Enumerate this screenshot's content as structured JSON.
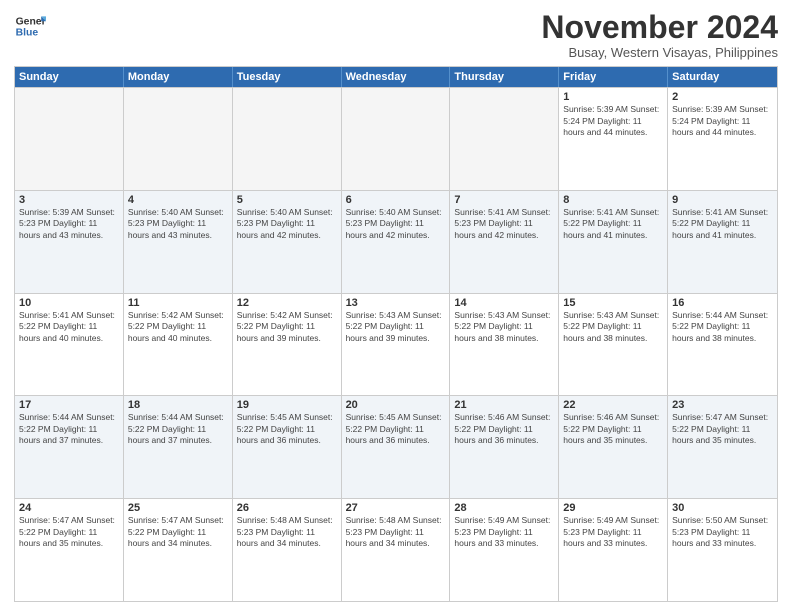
{
  "header": {
    "logo_line1": "General",
    "logo_line2": "Blue",
    "month": "November 2024",
    "location": "Busay, Western Visayas, Philippines"
  },
  "days_of_week": [
    "Sunday",
    "Monday",
    "Tuesday",
    "Wednesday",
    "Thursday",
    "Friday",
    "Saturday"
  ],
  "weeks": [
    [
      {
        "day": "",
        "info": ""
      },
      {
        "day": "",
        "info": ""
      },
      {
        "day": "",
        "info": ""
      },
      {
        "day": "",
        "info": ""
      },
      {
        "day": "",
        "info": ""
      },
      {
        "day": "1",
        "info": "Sunrise: 5:39 AM\nSunset: 5:24 PM\nDaylight: 11 hours\nand 44 minutes."
      },
      {
        "day": "2",
        "info": "Sunrise: 5:39 AM\nSunset: 5:24 PM\nDaylight: 11 hours\nand 44 minutes."
      }
    ],
    [
      {
        "day": "3",
        "info": "Sunrise: 5:39 AM\nSunset: 5:23 PM\nDaylight: 11 hours\nand 43 minutes."
      },
      {
        "day": "4",
        "info": "Sunrise: 5:40 AM\nSunset: 5:23 PM\nDaylight: 11 hours\nand 43 minutes."
      },
      {
        "day": "5",
        "info": "Sunrise: 5:40 AM\nSunset: 5:23 PM\nDaylight: 11 hours\nand 42 minutes."
      },
      {
        "day": "6",
        "info": "Sunrise: 5:40 AM\nSunset: 5:23 PM\nDaylight: 11 hours\nand 42 minutes."
      },
      {
        "day": "7",
        "info": "Sunrise: 5:41 AM\nSunset: 5:23 PM\nDaylight: 11 hours\nand 42 minutes."
      },
      {
        "day": "8",
        "info": "Sunrise: 5:41 AM\nSunset: 5:22 PM\nDaylight: 11 hours\nand 41 minutes."
      },
      {
        "day": "9",
        "info": "Sunrise: 5:41 AM\nSunset: 5:22 PM\nDaylight: 11 hours\nand 41 minutes."
      }
    ],
    [
      {
        "day": "10",
        "info": "Sunrise: 5:41 AM\nSunset: 5:22 PM\nDaylight: 11 hours\nand 40 minutes."
      },
      {
        "day": "11",
        "info": "Sunrise: 5:42 AM\nSunset: 5:22 PM\nDaylight: 11 hours\nand 40 minutes."
      },
      {
        "day": "12",
        "info": "Sunrise: 5:42 AM\nSunset: 5:22 PM\nDaylight: 11 hours\nand 39 minutes."
      },
      {
        "day": "13",
        "info": "Sunrise: 5:43 AM\nSunset: 5:22 PM\nDaylight: 11 hours\nand 39 minutes."
      },
      {
        "day": "14",
        "info": "Sunrise: 5:43 AM\nSunset: 5:22 PM\nDaylight: 11 hours\nand 38 minutes."
      },
      {
        "day": "15",
        "info": "Sunrise: 5:43 AM\nSunset: 5:22 PM\nDaylight: 11 hours\nand 38 minutes."
      },
      {
        "day": "16",
        "info": "Sunrise: 5:44 AM\nSunset: 5:22 PM\nDaylight: 11 hours\nand 38 minutes."
      }
    ],
    [
      {
        "day": "17",
        "info": "Sunrise: 5:44 AM\nSunset: 5:22 PM\nDaylight: 11 hours\nand 37 minutes."
      },
      {
        "day": "18",
        "info": "Sunrise: 5:44 AM\nSunset: 5:22 PM\nDaylight: 11 hours\nand 37 minutes."
      },
      {
        "day": "19",
        "info": "Sunrise: 5:45 AM\nSunset: 5:22 PM\nDaylight: 11 hours\nand 36 minutes."
      },
      {
        "day": "20",
        "info": "Sunrise: 5:45 AM\nSunset: 5:22 PM\nDaylight: 11 hours\nand 36 minutes."
      },
      {
        "day": "21",
        "info": "Sunrise: 5:46 AM\nSunset: 5:22 PM\nDaylight: 11 hours\nand 36 minutes."
      },
      {
        "day": "22",
        "info": "Sunrise: 5:46 AM\nSunset: 5:22 PM\nDaylight: 11 hours\nand 35 minutes."
      },
      {
        "day": "23",
        "info": "Sunrise: 5:47 AM\nSunset: 5:22 PM\nDaylight: 11 hours\nand 35 minutes."
      }
    ],
    [
      {
        "day": "24",
        "info": "Sunrise: 5:47 AM\nSunset: 5:22 PM\nDaylight: 11 hours\nand 35 minutes."
      },
      {
        "day": "25",
        "info": "Sunrise: 5:47 AM\nSunset: 5:22 PM\nDaylight: 11 hours\nand 34 minutes."
      },
      {
        "day": "26",
        "info": "Sunrise: 5:48 AM\nSunset: 5:23 PM\nDaylight: 11 hours\nand 34 minutes."
      },
      {
        "day": "27",
        "info": "Sunrise: 5:48 AM\nSunset: 5:23 PM\nDaylight: 11 hours\nand 34 minutes."
      },
      {
        "day": "28",
        "info": "Sunrise: 5:49 AM\nSunset: 5:23 PM\nDaylight: 11 hours\nand 33 minutes."
      },
      {
        "day": "29",
        "info": "Sunrise: 5:49 AM\nSunset: 5:23 PM\nDaylight: 11 hours\nand 33 minutes."
      },
      {
        "day": "30",
        "info": "Sunrise: 5:50 AM\nSunset: 5:23 PM\nDaylight: 11 hours\nand 33 minutes."
      }
    ]
  ]
}
